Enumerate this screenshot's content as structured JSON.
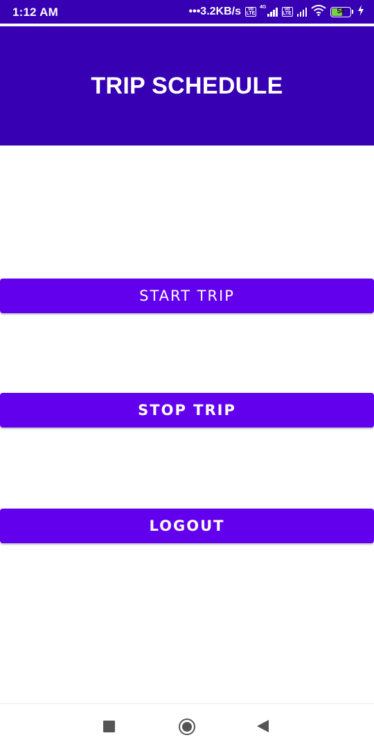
{
  "status_bar": {
    "time": "1:12 AM",
    "net_speed": "•••3.2KB/s",
    "volte_1": "Vo LTE",
    "volte_2": "Vo LTE",
    "network_type": "4G",
    "battery_level": "58",
    "battery_fraction": 0.58,
    "icons": [
      "volte-icon",
      "signal-4g-icon",
      "volte-icon",
      "signal-icon",
      "wifi-icon",
      "battery-icon",
      "charging-icon"
    ]
  },
  "header": {
    "title": "TRIP SCHEDULE"
  },
  "actions": {
    "start_label": "START TRIP",
    "stop_label": "STOP TRIP",
    "logout_label": "LOGOUT"
  },
  "nav": {
    "icons": [
      "recent-apps-icon",
      "home-icon",
      "back-icon"
    ]
  },
  "colors": {
    "header_bg": "#3700b3",
    "button_bg": "#6200ee",
    "text_on_primary": "#ffffff",
    "battery_fill": "#79d14a"
  }
}
